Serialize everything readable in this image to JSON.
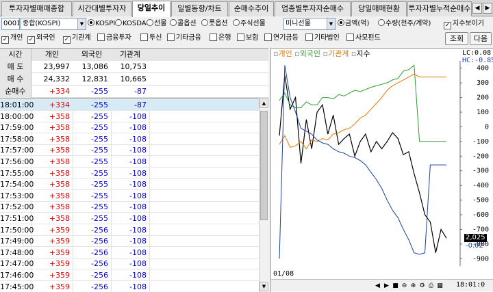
{
  "tabs": [
    {
      "label": "투자자별매매종합",
      "active": false
    },
    {
      "label": "시간대별투자자",
      "active": false
    },
    {
      "label": "당일추이",
      "active": true
    },
    {
      "label": "일별동향/차트",
      "active": false
    },
    {
      "label": "순매수추이",
      "active": false
    },
    {
      "label": "업종별투자자순매수",
      "active": false
    },
    {
      "label": "당일매매현황",
      "active": false
    },
    {
      "label": "투자자별누적순매수",
      "active": false
    }
  ],
  "toolbar": {
    "code_value": "0001",
    "market_value": "종합(KOSPI)",
    "market_radios": [
      {
        "label": "KOSPI",
        "checked": true
      },
      {
        "label": "KOSDAQ",
        "checked": false
      },
      {
        "label": "선물",
        "checked": false
      },
      {
        "label": "콜옵션",
        "checked": false
      },
      {
        "label": "풋옵션",
        "checked": false
      },
      {
        "label": "주식선물",
        "checked": false
      }
    ],
    "futures_value": "미니선물",
    "unit_radios": [
      {
        "label": "금액(억)",
        "checked": true
      },
      {
        "label": "수량(천주/계약)",
        "checked": false
      }
    ],
    "index_check_label": "지수보이기",
    "index_checked": true
  },
  "investor_checks": [
    {
      "label": "개인",
      "checked": true
    },
    {
      "label": "외국인",
      "checked": true
    },
    {
      "label": "기관계",
      "checked": true
    },
    {
      "label": "금융투자",
      "checked": false
    },
    {
      "label": "투신",
      "checked": false
    },
    {
      "label": "기타금융",
      "checked": false
    },
    {
      "label": "은행",
      "checked": false
    },
    {
      "label": "보험",
      "checked": false
    },
    {
      "label": "연기금등",
      "checked": false
    },
    {
      "label": "기타법인",
      "checked": false
    },
    {
      "label": "사모펀드",
      "checked": false
    }
  ],
  "buttons": {
    "query": "조회",
    "next": "다음"
  },
  "summary": {
    "headers": [
      "시간",
      "개인",
      "외국인",
      "기관계"
    ],
    "rows": [
      {
        "label": "매 도",
        "values": [
          "23,997",
          "13,086",
          "10,753"
        ]
      },
      {
        "label": "매 수",
        "values": [
          "24,332",
          "12,831",
          "10,665"
        ]
      },
      {
        "label": "순매수",
        "values": [
          "+334",
          "-255",
          "-87"
        ]
      }
    ]
  },
  "rows": [
    [
      "18:01:00",
      "+334",
      "-255",
      "-87"
    ],
    [
      "18:00:00",
      "+358",
      "-255",
      "-108"
    ],
    [
      "17:59:00",
      "+358",
      "-255",
      "-108"
    ],
    [
      "17:58:00",
      "+358",
      "-255",
      "-108"
    ],
    [
      "17:57:00",
      "+358",
      "-255",
      "-108"
    ],
    [
      "17:56:00",
      "+358",
      "-255",
      "-108"
    ],
    [
      "17:55:00",
      "+358",
      "-255",
      "-108"
    ],
    [
      "17:54:00",
      "+358",
      "-255",
      "-108"
    ],
    [
      "17:53:00",
      "+358",
      "-255",
      "-108"
    ],
    [
      "17:52:00",
      "+358",
      "-255",
      "-108"
    ],
    [
      "17:51:00",
      "+358",
      "-255",
      "-108"
    ],
    [
      "17:50:00",
      "+359",
      "-256",
      "-108"
    ],
    [
      "17:49:00",
      "+359",
      "-256",
      "-108"
    ],
    [
      "17:48:00",
      "+359",
      "-256",
      "-108"
    ],
    [
      "17:47:00",
      "+359",
      "-256",
      "-108"
    ],
    [
      "17:46:00",
      "+359",
      "-256",
      "-108"
    ],
    [
      "17:45:00",
      "+359",
      "-256",
      "-108"
    ]
  ],
  "colors": {
    "individual": "#000000",
    "foreign": "#2e9b2e",
    "institution": "#e07800",
    "index": "#1a3fa0",
    "up": "#e00000",
    "down": "#0000d0"
  },
  "chart_data": {
    "type": "line",
    "legend": [
      "개인",
      "외국인",
      "기관계",
      "지수"
    ],
    "right_info": {
      "lc": "LC:0.08",
      "hc": "HC:-0.85"
    },
    "ylim": [
      -950,
      450
    ],
    "yticks": [
      400,
      300,
      200,
      100,
      0,
      -100,
      -200,
      -300,
      -400,
      -500,
      -600,
      -700,
      -800,
      -900
    ],
    "x_label_left": "01/08",
    "x_label_right": "18:01:0",
    "last_value_label": "2,025",
    "last_value_label2": "-0.02",
    "series": [
      {
        "name": "개인",
        "color": "#000000",
        "values": [
          -60,
          350,
          120,
          200,
          -250,
          50,
          -150,
          100,
          150,
          -50,
          80,
          -120,
          -80,
          -50,
          -200,
          -100,
          -50,
          -170,
          -100,
          -150,
          -100,
          -40,
          -80,
          -190,
          -170,
          -320,
          -450,
          -600,
          -650,
          -860,
          -700,
          -760
        ]
      },
      {
        "name": "외국인",
        "color": "#2e9b2e",
        "values": [
          180,
          230,
          150,
          130,
          130,
          170,
          150,
          150,
          200,
          200,
          190,
          220,
          210,
          230,
          250,
          240,
          255,
          270,
          280,
          290,
          300,
          320,
          330,
          380,
          390,
          420,
          -100,
          -100,
          -100,
          -100,
          -100,
          -100
        ]
      },
      {
        "name": "기관계",
        "color": "#e07800",
        "values": [
          -120,
          -60,
          -140,
          -130,
          -100,
          -150,
          -90,
          -100,
          -80,
          -90,
          -50,
          -40,
          -20,
          -10,
          20,
          60,
          80,
          120,
          160,
          200,
          250,
          280,
          300,
          320,
          340,
          360,
          340,
          340,
          340,
          340,
          340,
          340
        ]
      },
      {
        "name": "지수",
        "color": "#1a3fa0",
        "values": [
          -900,
          420,
          200,
          100,
          -10,
          -30,
          -50,
          -90,
          -110,
          -120,
          -150,
          -170,
          -180,
          -200,
          -210,
          -230,
          -260,
          -310,
          -360,
          -420,
          -500,
          -570,
          -620,
          -700,
          -770,
          -860,
          -870,
          -860,
          -260,
          -260,
          -260,
          -260
        ]
      }
    ]
  }
}
